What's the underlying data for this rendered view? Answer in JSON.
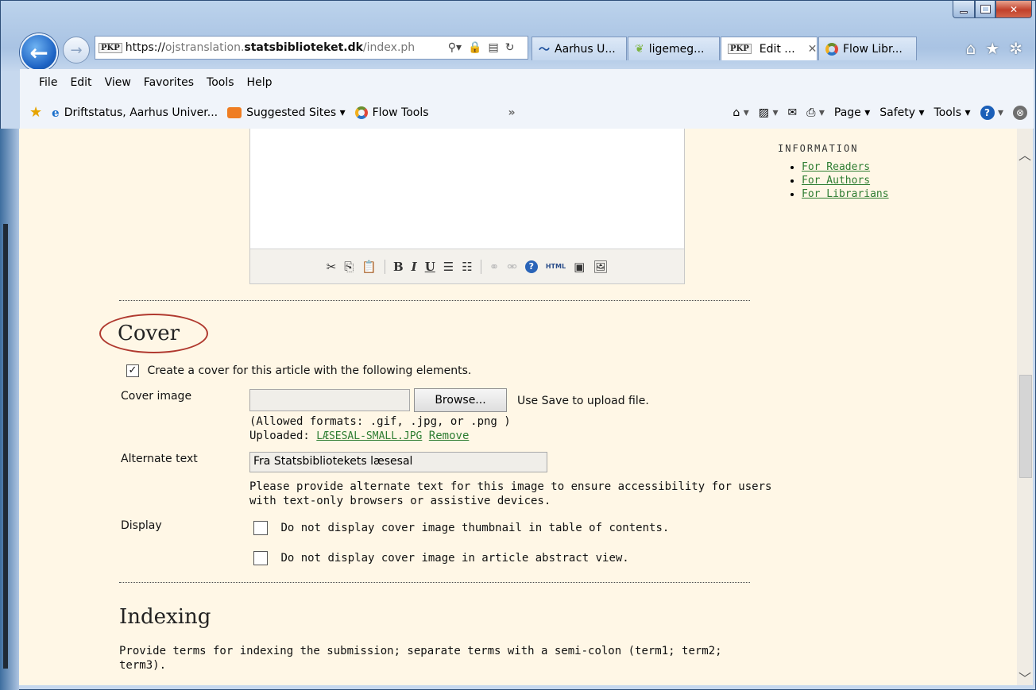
{
  "browser": {
    "address": {
      "favicon": "PKP",
      "url_prefix": "https://",
      "url_sub": "ojstranslation.",
      "url_domain": "statsbiblioteket.dk",
      "url_path": "/index.ph"
    },
    "tabs": [
      {
        "label": "Aarhus U...",
        "icon": "aarhus-icon"
      },
      {
        "label": "ligemeg...",
        "icon": "leaf-icon"
      },
      {
        "label": "Edit ...",
        "icon": "PKP",
        "active": true
      },
      {
        "label": "Flow Libr...",
        "icon": "flow-icon"
      }
    ],
    "menu": [
      "File",
      "Edit",
      "View",
      "Favorites",
      "Tools",
      "Help"
    ],
    "favorites": [
      {
        "label": "Driftstatus, Aarhus Univer...",
        "icon": "ie-icon"
      },
      {
        "label": "Suggested Sites ▾",
        "icon": "suggested-sites-icon"
      },
      {
        "label": "Flow Tools",
        "icon": "flow-icon"
      }
    ],
    "commands": {
      "page": "Page ▾",
      "safety": "Safety ▾",
      "tools": "Tools ▾"
    }
  },
  "sidebar": {
    "heading": "INFORMATION",
    "links": [
      "For Readers",
      "For Authors",
      "For Librarians"
    ]
  },
  "cover": {
    "title": "Cover",
    "create_checkbox": {
      "label": "Create a cover for this article with the following elements.",
      "checked": true
    },
    "image_label": "Cover image",
    "browse_label": "Browse...",
    "upload_hint": "Use Save to upload file.",
    "allowed_formats": "(Allowed formats: .gif, .jpg, or .png )",
    "uploaded_label": "Uploaded:",
    "uploaded_file": "LÆSESAL-SMALL.JPG",
    "remove_label": "Remove",
    "alt_label": "Alternate text",
    "alt_value": "Fra Statsbibliotekets læsesal",
    "alt_help_1": "Please provide alternate text for this image to ensure accessibility for users",
    "alt_help_2": "with text-only browsers or assistive devices.",
    "display_label": "Display",
    "display_opt_1": "Do not display cover image thumbnail in table of contents.",
    "display_opt_2": "Do not display cover image in article abstract view."
  },
  "indexing": {
    "title": "Indexing",
    "help_1": "Provide terms for indexing the submission; separate terms with a semi-colon (term1; term2;",
    "help_2": "term3)."
  },
  "colors": {
    "accent_ring": "#b0392f",
    "link": "#2e7d32",
    "page_bg": "#fff7e6"
  }
}
